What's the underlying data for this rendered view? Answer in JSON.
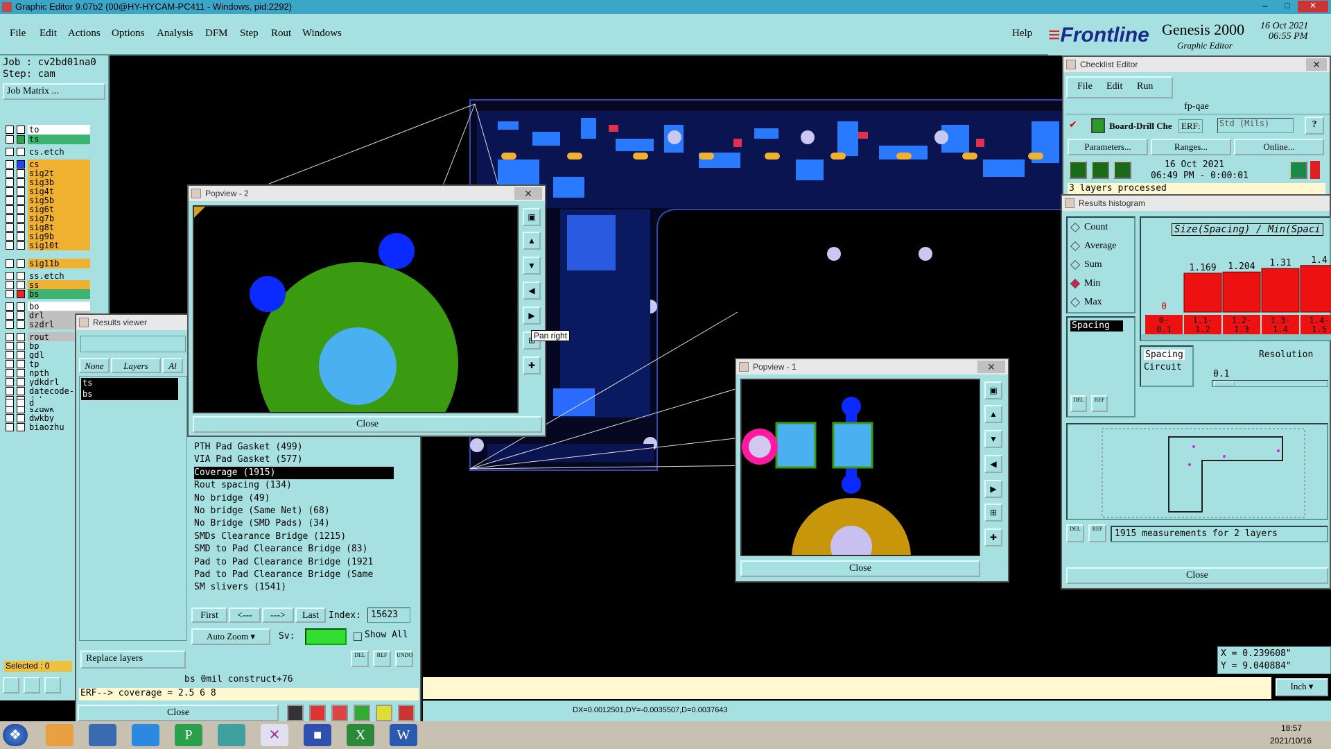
{
  "window": {
    "title": "Graphic Editor 9.07b2 (00@HY-HYCAM-PC411 - Windows, pid:2292)"
  },
  "menu": {
    "items": [
      "File",
      "Edit",
      "Actions",
      "Options",
      "Analysis",
      "DFM",
      "Step",
      "Rout",
      "Windows"
    ],
    "help": "Help"
  },
  "brand": {
    "logo": "Frontline",
    "product": "Genesis 2000",
    "subtitle": "Graphic Editor",
    "date": "16 Oct 2021",
    "time": "06:55 PM"
  },
  "left": {
    "job_line": "Job : cv2bd01na0",
    "step_line": "Step: cam",
    "job_matrix": "Job Matrix ...",
    "layers": [
      {
        "name": "to",
        "color": "#ffffff",
        "bg": "#ffffff"
      },
      {
        "name": "ts",
        "color": "#22aa44",
        "bg": "#3cb371"
      },
      {
        "name": "cs.etch",
        "color": "#ffffff",
        "bg": "#a6e0e0"
      },
      {
        "name": "cs",
        "color": "#2244ff",
        "bg": "#f0b030"
      },
      {
        "name": "sig2t",
        "color": "#ffffff",
        "bg": "#f0b030"
      },
      {
        "name": "sig3b",
        "color": "#ffffff",
        "bg": "#f0b030"
      },
      {
        "name": "sig4t",
        "color": "#ffffff",
        "bg": "#f0b030"
      },
      {
        "name": "sig5b",
        "color": "#ffffff",
        "bg": "#f0b030"
      },
      {
        "name": "sig6t",
        "color": "#ffffff",
        "bg": "#f0b030"
      },
      {
        "name": "sig7b",
        "color": "#ffffff",
        "bg": "#f0b030"
      },
      {
        "name": "sig8t",
        "color": "#ffffff",
        "bg": "#f0b030"
      },
      {
        "name": "sig9b",
        "color": "#ffffff",
        "bg": "#f0b030"
      },
      {
        "name": "sig10t",
        "color": "#ffffff",
        "bg": "#f0b030"
      },
      {
        "name": "sig11b",
        "color": "#ffffff",
        "bg": "#f0b030"
      },
      {
        "name": "ss.etch",
        "color": "#ffffff",
        "bg": "#a6e0e0"
      },
      {
        "name": "ss",
        "color": "#ffffff",
        "bg": "#f0b030"
      },
      {
        "name": "bs",
        "color": "#ee2222",
        "bg": "#3cb371"
      },
      {
        "name": "bo",
        "color": "#ffffff",
        "bg": "#ffffff"
      },
      {
        "name": "drl",
        "color": "#ffffff",
        "bg": "#c0c0c0"
      },
      {
        "name": "szdrl",
        "color": "#ffffff",
        "bg": "#c0c0c0"
      },
      {
        "name": "rout",
        "color": "#ffffff",
        "bg": "#c0c0c0"
      },
      {
        "name": "bp",
        "color": "#ffffff",
        "bg": "#a6e0e0"
      },
      {
        "name": "gdl",
        "color": "#ffffff",
        "bg": "#a6e0e0"
      },
      {
        "name": "tp",
        "color": "#ffffff",
        "bg": "#a6e0e0"
      },
      {
        "name": "npth",
        "color": "#ffffff",
        "bg": "#a6e0e0"
      },
      {
        "name": "ydkdrl",
        "color": "#ffffff",
        "bg": "#a6e0e0"
      },
      {
        "name": "datecode-",
        "color": "#ffffff",
        "bg": "#a6e0e0"
      },
      {
        "name": "dwk",
        "color": "#ffffff",
        "bg": "#a6e0e0"
      },
      {
        "name": "szdwk",
        "color": "#ffffff",
        "bg": "#a6e0e0"
      },
      {
        "name": "dwkby",
        "color": "#ffffff",
        "bg": "#a6e0e0"
      },
      {
        "name": "biaozhu",
        "color": "#ffffff",
        "bg": "#a6e0e0"
      },
      {
        "name": "d",
        "color": "#ffffff",
        "bg": "#a6e0e0"
      }
    ],
    "selected": "Selected : 0"
  },
  "results_viewer": {
    "title": "Results viewer",
    "tabs": [
      "None",
      "Layers",
      "Al"
    ],
    "layer_list": [
      "ts",
      "bs"
    ],
    "items": [
      "PTH Pad Gasket (499)",
      "VIA Pad Gasket (577)",
      "Coverage (1915)",
      "Rout spacing (134)",
      "No bridge (49)",
      "No bridge (Same Net) (68)",
      "No Bridge (SMD Pads) (34)",
      "SMDs Clearance Bridge (1215)",
      "SMD to Pad Clearance Bridge (83)",
      "Pad to Pad Clearance Bridge (1921",
      "Pad to Pad Clearance Bridge (Same",
      "SM slivers (1541)"
    ],
    "selected_index": 2,
    "nav": {
      "first": "First",
      "prev": "<---",
      "next": "--->",
      "last": "Last",
      "index_label": "Index:",
      "index_value": "15623"
    },
    "auto_zoom": "Auto Zoom",
    "sv_label": "Sv:",
    "show_all": "Show All",
    "replace_layers": "Replace layers",
    "mini_btns": [
      "DEL",
      "REF",
      "UNDO"
    ],
    "info_line": "bs  0mil  construct+76",
    "erf_line": "ERF--> coverage = 2.5 6 8",
    "close": "Close"
  },
  "popview2": {
    "title": "Popview - 2",
    "tooltip": "Pan right",
    "close": "Close"
  },
  "popview1": {
    "title": "Popview - 1",
    "close": "Close"
  },
  "checklist": {
    "title": "Checklist Editor",
    "menu": [
      "File",
      "Edit",
      "Run"
    ],
    "name": "fp-qae",
    "check_name": "Board-Drill Che",
    "erf_label": "ERF:",
    "erf_value": "Std (Mils)",
    "help": "?",
    "buttons": [
      "Parameters...",
      "Ranges...",
      "Online..."
    ],
    "run_date": "16 Oct 2021",
    "run_time": "06:49 PM - 0:00:01",
    "status": "3 layers processed"
  },
  "histogram": {
    "title": "Results histogram",
    "modes": [
      "Count",
      "Average",
      "Sum",
      "Min",
      "Max"
    ],
    "selected_mode": "Min",
    "category": "Spacing",
    "heading": "Size(Spacing) / Min(Spaci",
    "bars": [
      {
        "label": "0-\n0.1",
        "value": 0
      },
      {
        "label": "1.1-\n1.2",
        "value": 1.169
      },
      {
        "label": "1.2-\n1.3",
        "value": 1.204
      },
      {
        "label": "1.3-\n1.4",
        "value": 1.31
      },
      {
        "label": "1.4-\n1.5",
        "value": 1.4
      }
    ],
    "bar_labels": [
      "0",
      "1.169",
      "1.204",
      "1.31",
      "1.4"
    ],
    "bin_labels": [
      "0-",
      "0.1",
      "1.1-",
      "1.2",
      "1.2-",
      "1.3",
      "1.3-",
      "1.4",
      "1.4-",
      "1.5"
    ],
    "list_options": [
      "Spacing",
      "Circuit"
    ],
    "resolution_label": "Resolution",
    "resolution_value": "0.1",
    "measurements": "1915 measurements for 2 layers",
    "close": "Close"
  },
  "coords": {
    "x": "X = 0.239608\"",
    "y": "Y = 9.040884\""
  },
  "units": "Inch",
  "status": {
    "delta": "DX=0.0012501,DY=-0.0035507,D=0.0037643"
  },
  "taskbar": {
    "time": "18:57",
    "date": "2021/10/16"
  }
}
